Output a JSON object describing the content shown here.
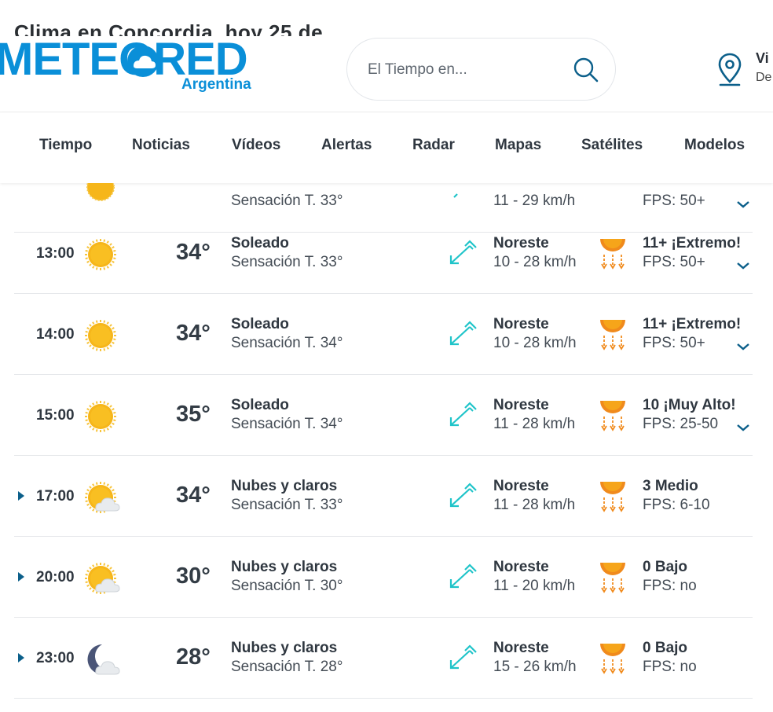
{
  "page": {
    "title_behind": "Clima en Concordia, hoy 25 de"
  },
  "logo": {
    "word": "METEORED",
    "sub": "Argentina"
  },
  "search": {
    "placeholder": "El Tiempo en...",
    "icon": "search-icon"
  },
  "location": {
    "name": "Vi",
    "sub": "De"
  },
  "nav": [
    "Tiempo",
    "Noticias",
    "Vídeos",
    "Alertas",
    "Radar",
    "Mapas",
    "Satélites",
    "Modelos"
  ],
  "colors": {
    "brand": "#0a8fd8",
    "wind": "#1fc4c9",
    "sun": "#f6b61a",
    "uv": "#f08a1c",
    "dark": "#0b5f8a"
  },
  "partial_row": {
    "feel": "Sensación T. 33°",
    "speed": "11 - 29 km/h",
    "fps": "FPS: 50+"
  },
  "rows": [
    {
      "hour": "13:00",
      "icon": "sun-icon",
      "temp": "34°",
      "cond": "Soleado",
      "feel": "Sensación T. 33°",
      "wind_dir": "Noreste",
      "wind_speed": "10 - 28 km/h",
      "uv": "11+ ¡Extremo!",
      "fps": "FPS: 50+",
      "expandable_chevron": true,
      "expander": false
    },
    {
      "hour": "14:00",
      "icon": "sun-icon",
      "temp": "34°",
      "cond": "Soleado",
      "feel": "Sensación T. 34°",
      "wind_dir": "Noreste",
      "wind_speed": "10 - 28 km/h",
      "uv": "11+ ¡Extremo!",
      "fps": "FPS: 50+",
      "expandable_chevron": true,
      "expander": false
    },
    {
      "hour": "15:00",
      "icon": "sun-icon",
      "temp": "35°",
      "cond": "Soleado",
      "feel": "Sensación T. 34°",
      "wind_dir": "Noreste",
      "wind_speed": "11 - 28 km/h",
      "uv": "10 ¡Muy Alto!",
      "fps": "FPS: 25-50",
      "expandable_chevron": true,
      "expander": false
    },
    {
      "hour": "17:00",
      "icon": "sun-cloud-icon",
      "temp": "34°",
      "cond": "Nubes y claros",
      "feel": "Sensación T. 33°",
      "wind_dir": "Noreste",
      "wind_speed": "11 - 28 km/h",
      "uv": "3 Medio",
      "fps": "FPS: 6-10",
      "expandable_chevron": false,
      "expander": true
    },
    {
      "hour": "20:00",
      "icon": "sun-cloud-icon",
      "temp": "30°",
      "cond": "Nubes y claros",
      "feel": "Sensación T. 30°",
      "wind_dir": "Noreste",
      "wind_speed": "11 - 20 km/h",
      "uv": "0 Bajo",
      "fps": "FPS: no",
      "expandable_chevron": false,
      "expander": true
    },
    {
      "hour": "23:00",
      "icon": "moon-cloud-icon",
      "temp": "28°",
      "cond": "Nubes y claros",
      "feel": "Sensación T. 28°",
      "wind_dir": "Noreste",
      "wind_speed": "15 - 26 km/h",
      "uv": "0 Bajo",
      "fps": "FPS: no",
      "expandable_chevron": false,
      "expander": true
    }
  ]
}
